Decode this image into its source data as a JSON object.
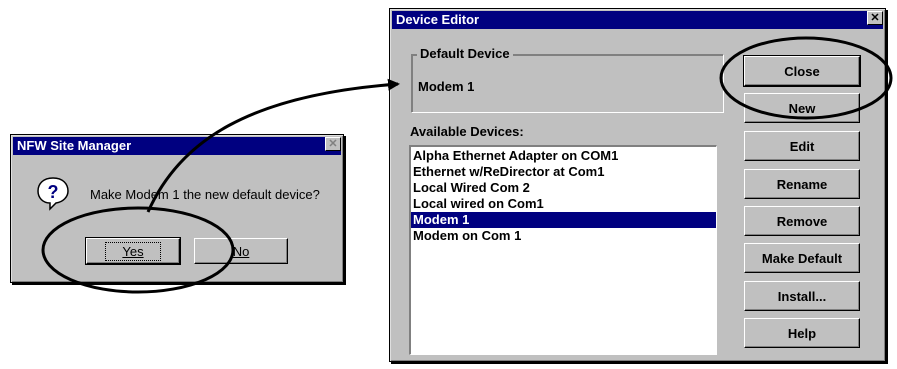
{
  "nfw_dialog": {
    "title": "NFW Site Manager",
    "message": "Make Modem 1 the new default device?",
    "question_icon_glyph": "?",
    "close_glyph": "✕",
    "yes_label": "Yes",
    "no_label": "No"
  },
  "device_editor": {
    "title": "Device Editor",
    "close_glyph": "✕",
    "default_device_group_label": "Default Device",
    "default_device_value": "Modem 1",
    "available_devices_label": "Available Devices:",
    "devices": [
      "Alpha Ethernet Adapter on COM1",
      "Ethernet w/ReDirector at Com1",
      "Local Wired Com 2",
      "Local wired on Com1",
      "Modem 1",
      "Modem on Com 1"
    ],
    "selected_device": "Modem 1",
    "buttons": {
      "close": "Close",
      "new": "New",
      "edit": "Edit",
      "rename": "Rename",
      "remove": "Remove",
      "make_default": "Make Default",
      "install": "Install...",
      "help": "Help"
    }
  },
  "colors": {
    "titlebar": "#000080",
    "face": "#c0c0c0",
    "selection": "#000080"
  }
}
